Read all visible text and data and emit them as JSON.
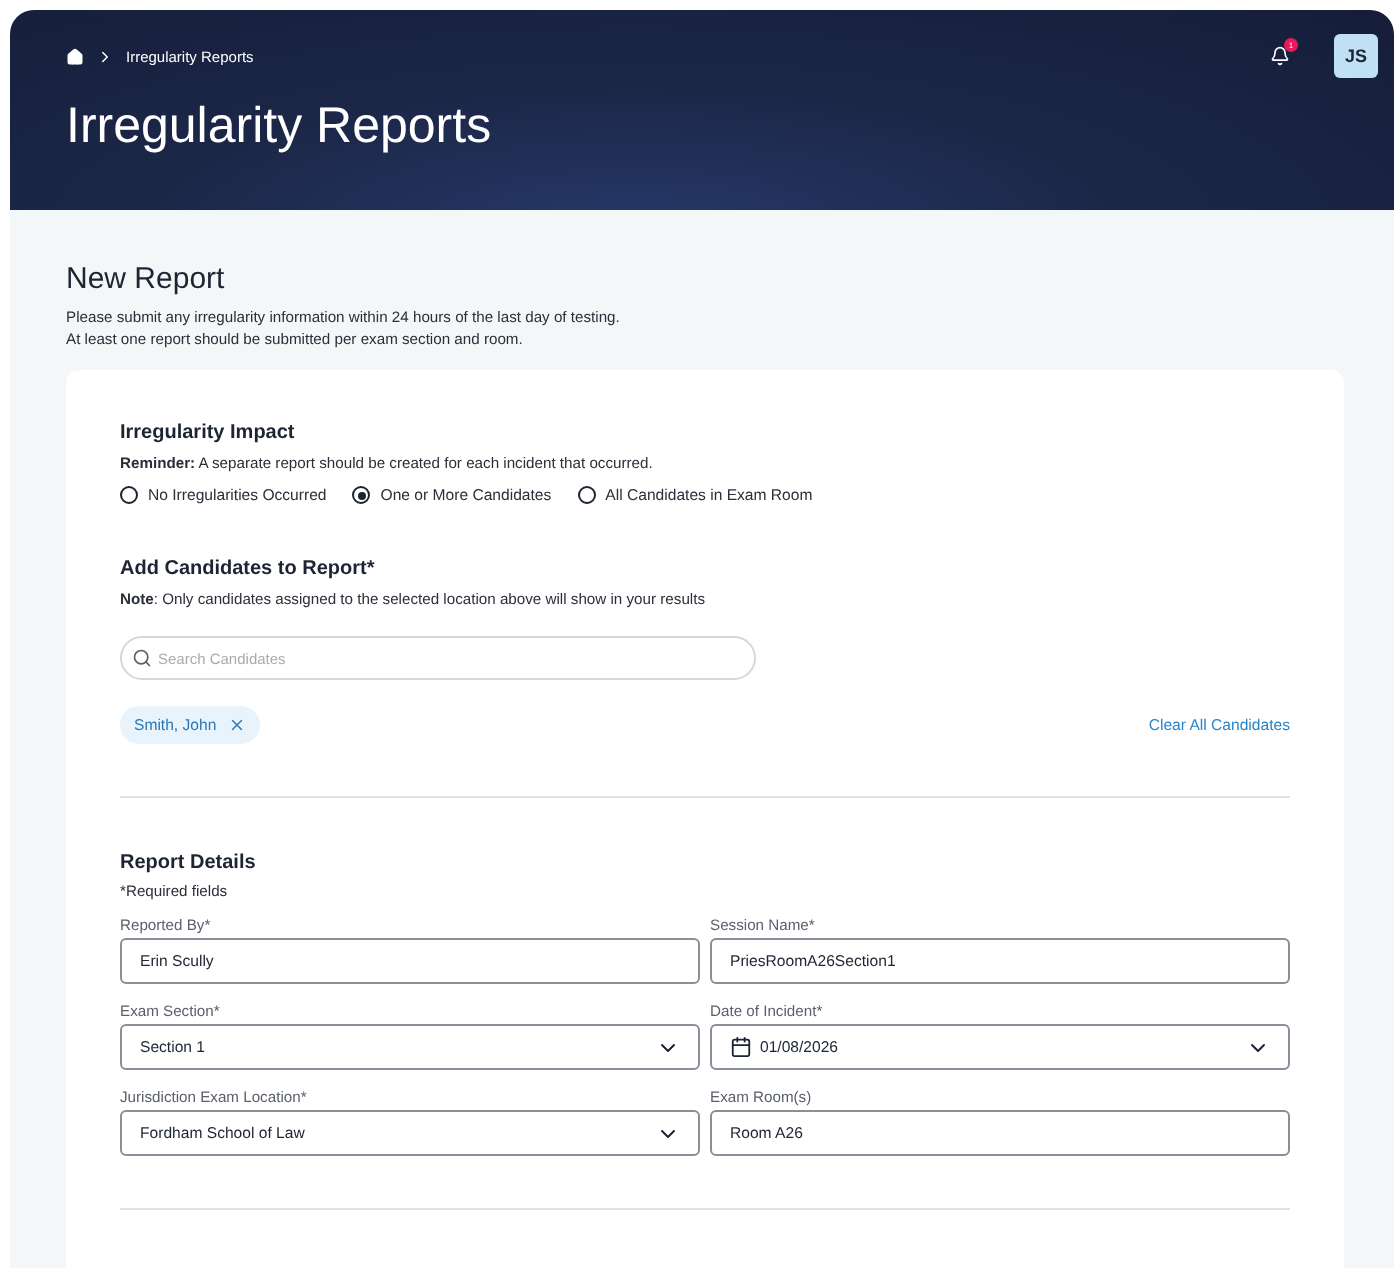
{
  "header": {
    "breadcrumb": [
      "Irregularity Reports"
    ],
    "title": "Irregularity Reports",
    "notification_count": "1",
    "avatar": "JS"
  },
  "intro": {
    "title": "New Report",
    "lines": [
      "Please submit any irregularity information within 24 hours of the last day of testing.",
      "At least one report should be submitted per exam section and room."
    ]
  },
  "impact": {
    "title": "Irregularity Impact",
    "note": "**Reminder:** A separate report should be created for each incident that occurred.",
    "options": [
      {
        "label": "No Irregularities Occurred",
        "selected": false
      },
      {
        "label": "One or More Candidates",
        "selected": true
      },
      {
        "label": "All Candidates in Exam Room",
        "selected": false
      }
    ]
  },
  "candidates": {
    "title": "Add Candidates to Report*",
    "note": "**Note**: Only candidates assigned to the selected location above will show in your results",
    "search": {
      "placeholder": "Search Candidates"
    },
    "chips": [
      "Smith, John"
    ],
    "clear_link": "Clear All Candidates"
  },
  "details": {
    "title": "Report Details",
    "required_note": "*Required fields",
    "fields": [
      {
        "label": "Reported By*",
        "value": "Erin Scully",
        "kind": "text"
      },
      {
        "label": "Session Name*",
        "value": "PriesRoomA26Section1",
        "kind": "text"
      },
      {
        "label": "Exam Section*",
        "value": "Section 1",
        "kind": "select"
      },
      {
        "label": "Date of Incident*",
        "value": "01/08/2026",
        "kind": "date"
      },
      {
        "label": "Jurisdiction Exam Location*",
        "value": "Fordham School of Law",
        "kind": "select"
      },
      {
        "label": "Exam Room(s)",
        "value": "Room A26",
        "kind": "text"
      }
    ]
  }
}
